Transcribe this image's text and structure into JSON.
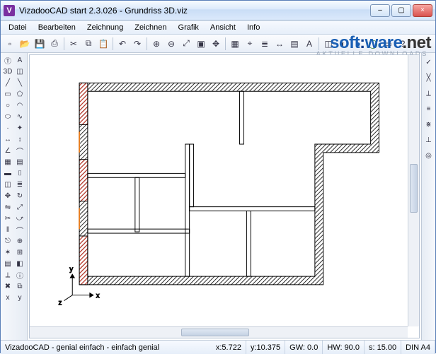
{
  "window": {
    "title": "VizadooCAD start  2.3.026  - Grundriss 3D.viz",
    "min": "–",
    "max": "▢",
    "close": "×",
    "icon_letter": "V"
  },
  "menu": {
    "items": [
      "Datei",
      "Bearbeiten",
      "Zeichnung",
      "Zeichnen",
      "Grafik",
      "Ansicht",
      "Info"
    ]
  },
  "watermark": {
    "brand_a": "soft",
    "brand_b": "ware",
    "brand_c": ".net",
    "sub": "AKTUELLE DOWNLOADS"
  },
  "toolbar": {
    "icons": [
      "new",
      "open",
      "save",
      "print",
      "cut",
      "copy",
      "paste",
      "undo",
      "redo",
      "zoom-in",
      "zoom-out",
      "zoom-fit",
      "zoom-window",
      "pan",
      "grid",
      "snap",
      "layer",
      "dim",
      "hatch",
      "text",
      "3d",
      "render",
      "circle-b",
      "circle-g",
      "rect",
      "help"
    ]
  },
  "left_tools": {
    "rows": [
      [
        "select",
        "text-tool"
      ],
      [
        "3d-view",
        "iso-view"
      ],
      [
        "line",
        "polyline"
      ],
      [
        "rect",
        "polygon"
      ],
      [
        "circle",
        "arc"
      ],
      [
        "ellipse",
        "spline"
      ],
      [
        "point",
        "marker"
      ],
      [
        "dim-h",
        "dim-v"
      ],
      [
        "dim-a",
        "dim-r"
      ],
      [
        "hatch",
        "fill"
      ],
      [
        "wall",
        "door"
      ],
      [
        "window",
        "stair"
      ],
      [
        "move",
        "rotate"
      ],
      [
        "mirror",
        "scale"
      ],
      [
        "trim",
        "extend"
      ],
      [
        "offset",
        "fillet"
      ],
      [
        "break",
        "join"
      ],
      [
        "explode",
        "group"
      ],
      [
        "layer-t",
        "color-t"
      ],
      [
        "measure",
        "info"
      ],
      [
        "erase",
        "copy-t"
      ],
      [
        "axis-x",
        "axis-y"
      ]
    ],
    "glyphs": [
      [
        "Ⓣ",
        "A"
      ],
      [
        "3D",
        "◫"
      ],
      [
        "╱",
        "╲"
      ],
      [
        "▭",
        "⬠"
      ],
      [
        "○",
        "◠"
      ],
      [
        "⬭",
        "∿"
      ],
      [
        "·",
        "✦"
      ],
      [
        "↔",
        "↕"
      ],
      [
        "∠",
        "⌒"
      ],
      [
        "▦",
        "▤"
      ],
      [
        "▬",
        "⌷"
      ],
      [
        "◫",
        "≣"
      ],
      [
        "✥",
        "↻"
      ],
      [
        "⇋",
        "⤢"
      ],
      [
        "✂",
        "⤻"
      ],
      [
        "‖",
        "⌒"
      ],
      [
        "⎋",
        "⊕"
      ],
      [
        "✶",
        "⊞"
      ],
      [
        "▤",
        "◧"
      ],
      [
        "⟂",
        "ⓘ"
      ],
      [
        "✖",
        "⧉"
      ],
      [
        "x",
        "y"
      ]
    ]
  },
  "right_tools": {
    "icons": [
      "check",
      "ortho",
      "snap-end",
      "snap-mid",
      "snap-int",
      "snap-perp",
      "snap-cen"
    ],
    "glyphs": [
      "✓",
      "╳",
      "⟂",
      "≡",
      "⋇",
      "⊥",
      "◎"
    ]
  },
  "axis": {
    "x": "x",
    "y": "y",
    "z": "z"
  },
  "status": {
    "tagline": "VizadooCAD - genial einfach - einfach genial",
    "x_label": "x:",
    "x_val": "5.722",
    "y_label": "y:",
    "y_val": "10.375",
    "gw_label": "GW:",
    "gw_val": "0.0",
    "hw_label": "HW:",
    "hw_val": "90.0",
    "s_label": "s:",
    "s_val": "15.00",
    "format": "DIN A4"
  }
}
